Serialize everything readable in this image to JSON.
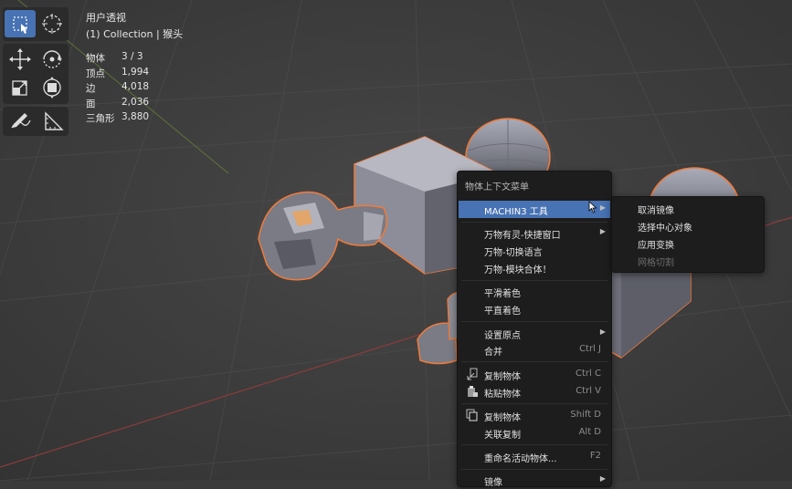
{
  "viewport_info": {
    "view_name": "用户透视",
    "collection_line": "(1) Collection | 猴头"
  },
  "stats": [
    {
      "key": "物体",
      "value": "3 / 3"
    },
    {
      "key": "顶点",
      "value": "1,994"
    },
    {
      "key": "边",
      "value": "4,018"
    },
    {
      "key": "面",
      "value": "2,036"
    },
    {
      "key": "三角形",
      "value": "3,880"
    }
  ],
  "toolbar": [
    {
      "icon": "select-box-icon",
      "active": true
    },
    {
      "icon": "cursor-icon",
      "active": false
    },
    {
      "icon": "move-icon",
      "active": false
    },
    {
      "icon": "rotate-icon",
      "active": false
    },
    {
      "icon": "scale-icon",
      "active": false
    },
    {
      "icon": "transform-icon",
      "active": false
    },
    {
      "icon": "annotate-icon",
      "active": false
    },
    {
      "icon": "measure-icon",
      "active": false
    }
  ],
  "context_menu": {
    "title": "物体上下文菜单",
    "items": {
      "machin3": {
        "label": "MACHIN3 工具",
        "shortcut": ""
      },
      "quick_window": {
        "label": "万物有灵-快捷窗口",
        "shortcut": ""
      },
      "switch_lang": {
        "label": "万物-切换语言",
        "shortcut": ""
      },
      "module_combine": {
        "label": "万物-模块合体！",
        "shortcut": ""
      },
      "shade_smooth": {
        "label": "平滑着色",
        "shortcut": ""
      },
      "shade_flat": {
        "label": "平直着色",
        "shortcut": ""
      },
      "set_origin": {
        "label": "设置原点",
        "shortcut": ""
      },
      "join": {
        "label": "合并",
        "shortcut": "Ctrl J"
      },
      "copy_objects": {
        "label": "复制物体",
        "shortcut": "Ctrl C"
      },
      "paste_objects": {
        "label": "粘贴物体",
        "shortcut": "Ctrl V"
      },
      "duplicate": {
        "label": "复制物体",
        "shortcut": "Shift D"
      },
      "linked_duplicate": {
        "label": "关联复制",
        "shortcut": "Alt D"
      },
      "rename_active": {
        "label": "重命名活动物体...",
        "shortcut": "F2"
      },
      "mirror": {
        "label": "镜像",
        "shortcut": ""
      }
    }
  },
  "submenu": {
    "items": {
      "cancel_mirror": {
        "label": "取消镜像"
      },
      "select_center": {
        "label": "选择中心对象"
      },
      "apply_transform": {
        "label": "应用变换"
      },
      "mesh_cut": {
        "label": "网格切割"
      }
    }
  }
}
